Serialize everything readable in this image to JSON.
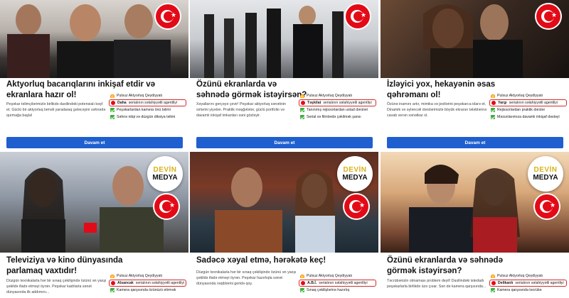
{
  "badge": {
    "line1": "DEVİN",
    "line2": "MEDYA"
  },
  "cards": [
    {
      "title": "Aktyorluq bacarıqlarını inkişaf etdir və ekranlara hazır ol!",
      "description": "Peşəkar təlimçilərimizlə birlikdə daxilindəki potensialı kəşf et. Güclü bir aktyorluq təməli yaradaraq gələcəyini səhnədə qurmağa başla!",
      "features": [
        "Pulsuz Aktyorluq Qeydiyyatı",
        "Daha",
        "serialının səlahiyyətli agentliyi",
        "Peşəkarlardan kamera önü təlimi",
        "Səhnə nitqi və düzgün diksiya təlimi"
      ],
      "button": "Davam et"
    },
    {
      "title": "Özünü ekranlarda və səhnədə görmək istəyirsən?",
      "description": "Xəyallarını gerçəyə çevir! Peşəkar aktyorluq sənətinin sirlərini yiyələn. Praktik məşğələlər, güclü portfolio və davamlı inkişaf imkanları səni gözləyir.",
      "features": [
        "Pulsuz Aktyorluq Qeydiyyatı",
        "Təşkilat",
        "serialının səlahiyyətli agentliyi",
        "Tanınmış rejissorlardan ustad dərsləri",
        "Serial və filmlərdə çəkilmək şansı"
      ],
      "button": "Davam et"
    },
    {
      "title": "İzləyici yox, hekayənin əsas qəhrəmanı ol!",
      "description": "Özünə inamını artır, mimika və jestlərini peşəkarca idarə et. Dinamik və əyləncəli dərslərimizlə böyük ekranın tələblərinə cavab verən sənətkar ol.",
      "features": [
        "Pulsuz Aktyorluq Qeydiyyatı",
        "Yargı",
        "serialının səlahiyyətli agentliyi",
        "Rejissorlardan praktik dərslər",
        "Məzunlarımıza davamlı inkişaf dəstəyi"
      ],
      "button": "Davam et"
    },
    {
      "title": "Televiziya və kino dünyasında parlamaq vaxtıdır!",
      "description": "Düzgün texnikalarla hər bir sınaq çəkilişində özünü ən yaxşı şəkildə ifadə etməyi öyrən. Peşəkar kadrlarla sənət dünyasında ilk addımını...",
      "features": [
        "Pulsuz Aktyorluq Qeydiyyatı",
        "Alsancak",
        "serialının səlahiyyətli agentliyi",
        "Kamera qarşısında özünüzü etirmək"
      ],
      "button": "Davam et"
    },
    {
      "title": "Sadəcə xəyal etmə, hərəkətə keç!",
      "description": "Düzgün texnikalarla hər bir sınaq çəkilişində özünü ən yaxşı şəkildə ifadə etməyi öyrən. Peşəkar hazırlıqla sənət dünyasında rəqiblərini geridə qoy.",
      "features": [
        "Pulsuz Aktyorluq Qeydiyyatı",
        "A.B.İ.",
        "serialının səlahiyyətli agentliyi",
        "Sınaq çəkilişlərinə hazırlıq"
      ],
      "button": "Davam et"
    },
    {
      "title": "Özünü ekranlarda və səhnədə görmək istəyirsən?",
      "description": "Təcrübənizin olmaması problem deyil! Daxilindəki istedadı peşəkarlarla birlikdə üzə çıxar. Sən də kamera qarşısında...",
      "features": [
        "Pulsuz Aktyorluq Qeydiyyatı",
        "Delikanlı",
        "serialının səlahiyyətli agentliyi",
        "Kamera qarşısında təcrübə"
      ],
      "button": "Davam et"
    }
  ],
  "colors": {
    "button": "#1f5fcf",
    "flag": "#e30a17",
    "highlight": "#d42a2a",
    "check": "#3cae3c"
  }
}
